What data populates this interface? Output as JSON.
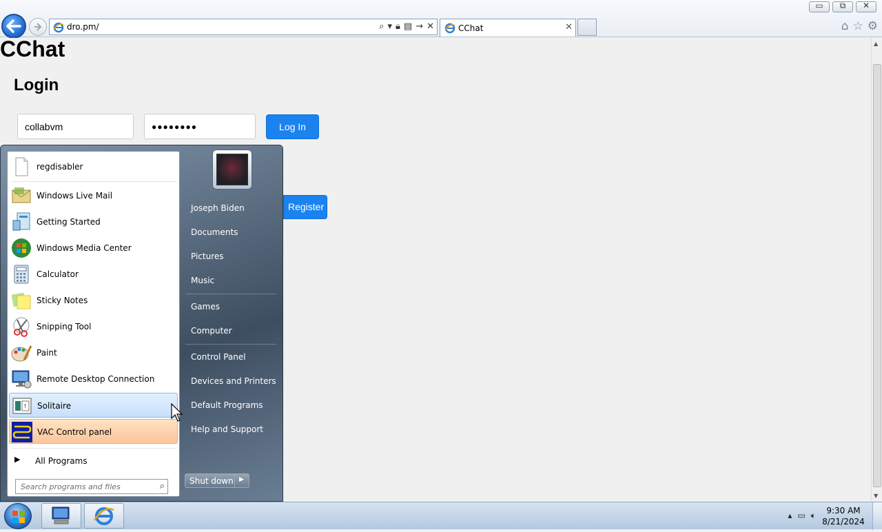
{
  "browser": {
    "url": "dro.pm/",
    "tab_title": "CChat",
    "window_buttons": [
      "minimize",
      "maximize",
      "close"
    ]
  },
  "page": {
    "site_title": "CChat",
    "login_heading": "Login",
    "username_value": "collabvm",
    "password_mask": "●●●●●●●●",
    "login_button": "Log In",
    "register_button": "Register"
  },
  "start_menu": {
    "left_items": [
      {
        "label": "regdisabler",
        "icon": "document-icon"
      },
      {
        "label": "Windows Live Mail",
        "icon": "mail-icon"
      },
      {
        "label": "Getting Started",
        "icon": "getting-started-icon"
      },
      {
        "label": "Windows Media Center",
        "icon": "media-center-icon"
      },
      {
        "label": "Calculator",
        "icon": "calculator-icon"
      },
      {
        "label": "Sticky Notes",
        "icon": "sticky-notes-icon"
      },
      {
        "label": "Snipping Tool",
        "icon": "scissors-icon"
      },
      {
        "label": "Paint",
        "icon": "paint-icon"
      },
      {
        "label": "Remote Desktop Connection",
        "icon": "remote-desktop-icon"
      },
      {
        "label": "Solitaire",
        "icon": "solitaire-icon"
      },
      {
        "label": "VAC Control panel",
        "icon": "vac-icon"
      }
    ],
    "all_programs": "All Programs",
    "search_placeholder": "Search programs and files",
    "right_items": [
      "Joseph Biden",
      "Documents",
      "Pictures",
      "Music",
      "Games",
      "Computer",
      "Control Panel",
      "Devices and Printers",
      "Default Programs",
      "Help and Support"
    ],
    "shutdown_label": "Shut down"
  },
  "taskbar": {
    "time": "9:30 AM",
    "date": "8/21/2024"
  },
  "colors": {
    "accent_blue": "#1a83f0",
    "hover_blue": "#c7e0fb",
    "highlight_orange": "#fbc59b"
  }
}
